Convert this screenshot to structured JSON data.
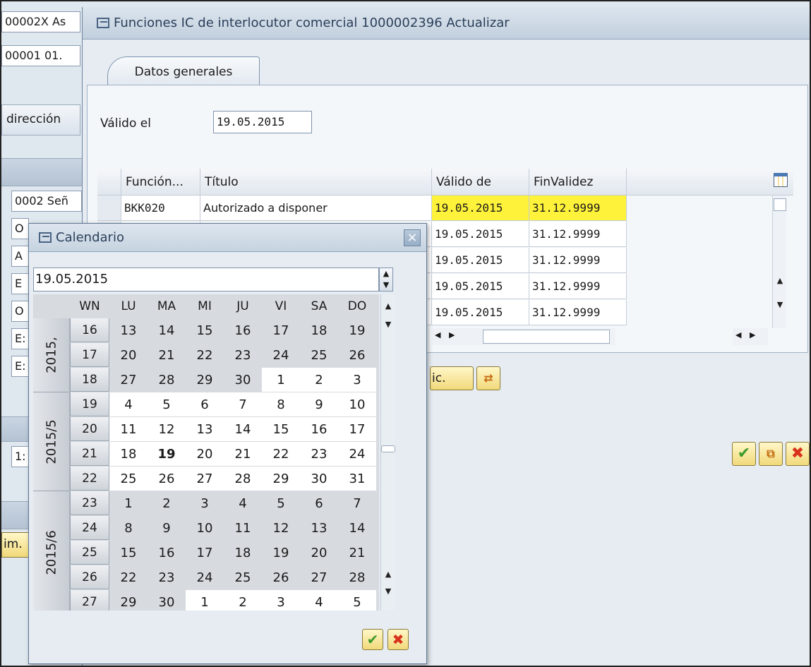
{
  "background": {
    "field1": "00002X As",
    "field2": "00001 01.",
    "tab_direccion": "dirección",
    "fields_left": [
      "0002 Señ",
      "O",
      "A",
      "E",
      "O",
      "E:",
      "E:"
    ],
    "field_bottom": "1:",
    "button_im": "im."
  },
  "main_dialog": {
    "title": "Funciones IC de interlocutor comercial 1000002396 Actualizar",
    "tab_label": "Datos generales",
    "valid_label": "Válido el",
    "valid_value": "19.05.2015",
    "table": {
      "headers": [
        "Función...",
        "Título",
        "Válido de",
        "FinValidez"
      ],
      "rows": [
        [
          "BKK020",
          "Autorizado a disponer",
          "19.05.2015",
          "31.12.9999"
        ],
        [
          "",
          "",
          "19.05.2015",
          "31.12.9999"
        ],
        [
          "",
          "",
          "19.05.2015",
          "31.12.9999"
        ],
        [
          "",
          "",
          "19.05.2015",
          "31.12.9999"
        ],
        [
          "",
          "",
          "19.05.2015",
          "31.12.9999"
        ]
      ]
    },
    "button_partial": "ic."
  },
  "calendar": {
    "title": "Calendario",
    "date_value": "19.05.2015",
    "headers": [
      "WN",
      "LU",
      "MA",
      "MI",
      "JU",
      "VI",
      "SA",
      "DO"
    ],
    "months": [
      {
        "label": "2015,",
        "weeks": [
          {
            "wn": "16",
            "days": [
              "13",
              "14",
              "15",
              "16",
              "17",
              "18",
              "19"
            ]
          },
          {
            "wn": "17",
            "days": [
              "20",
              "21",
              "22",
              "23",
              "24",
              "25",
              "26"
            ]
          },
          {
            "wn": "18",
            "days": [
              "27",
              "28",
              "29",
              "30",
              "1",
              "2",
              "3"
            ]
          }
        ]
      },
      {
        "label": "2015/5",
        "weeks": [
          {
            "wn": "19",
            "days": [
              "4",
              "5",
              "6",
              "7",
              "8",
              "9",
              "10"
            ]
          },
          {
            "wn": "20",
            "days": [
              "11",
              "12",
              "13",
              "14",
              "15",
              "16",
              "17"
            ]
          },
          {
            "wn": "21",
            "days": [
              "18",
              "19",
              "20",
              "21",
              "22",
              "23",
              "24"
            ]
          },
          {
            "wn": "22",
            "days": [
              "25",
              "26",
              "27",
              "28",
              "29",
              "30",
              "31"
            ]
          }
        ]
      },
      {
        "label": "2015/6",
        "weeks": [
          {
            "wn": "23",
            "days": [
              "1",
              "2",
              "3",
              "4",
              "5",
              "6",
              "7"
            ]
          },
          {
            "wn": "24",
            "days": [
              "8",
              "9",
              "10",
              "11",
              "12",
              "13",
              "14"
            ]
          },
          {
            "wn": "25",
            "days": [
              "15",
              "16",
              "17",
              "18",
              "19",
              "20",
              "21"
            ]
          },
          {
            "wn": "26",
            "days": [
              "22",
              "23",
              "24",
              "25",
              "26",
              "27",
              "28"
            ]
          },
          {
            "wn": "27",
            "days": [
              "29",
              "30",
              "1",
              "2",
              "3",
              "4",
              "5"
            ]
          }
        ]
      }
    ],
    "today": "19"
  },
  "icons": {
    "confirm": "check-icon",
    "cancel": "cross-icon",
    "close": "close-icon",
    "columns": "column-layout-icon"
  },
  "colors": {
    "highlight": "#fff23a",
    "title_text": "#2b3f5a",
    "cancel_red": "#d8321c",
    "confirm_green": "#3c9a2a"
  }
}
